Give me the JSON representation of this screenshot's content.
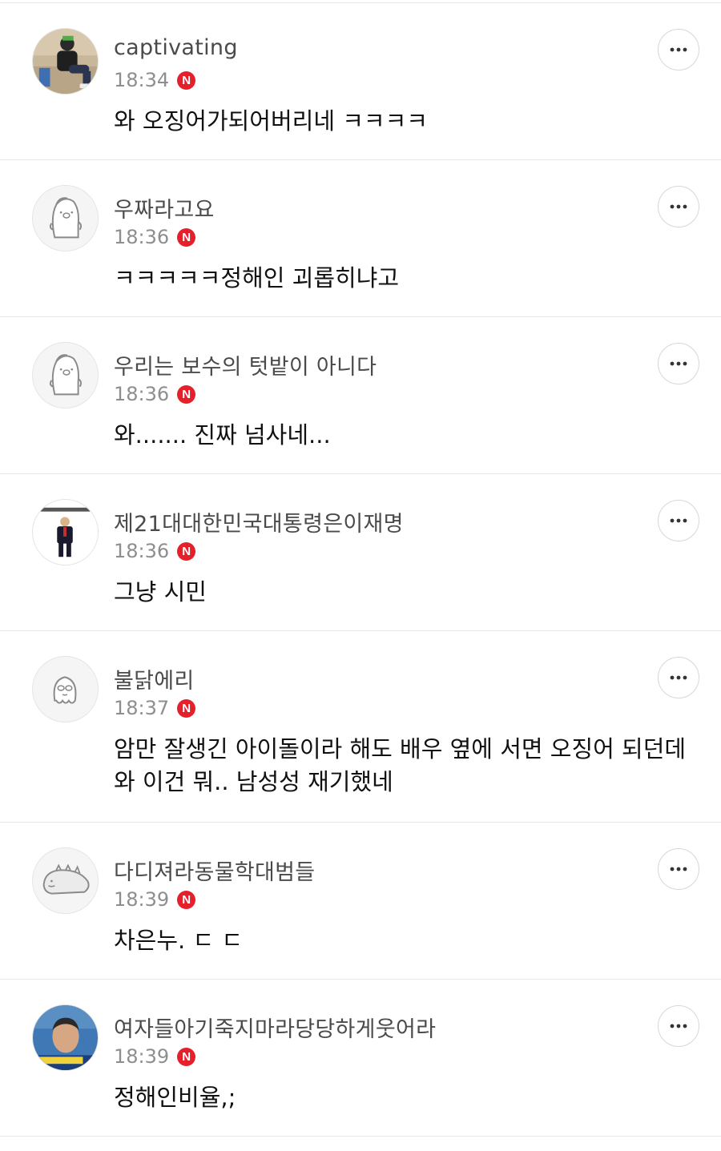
{
  "comments": [
    {
      "nickname": "captivating",
      "time": "18:34",
      "badge": "N",
      "body": "와 오징어가되어버리네 ㅋㅋㅋㅋ",
      "avatar": "photo-person-sitting"
    },
    {
      "nickname": "우짜라고요",
      "time": "18:36",
      "badge": "N",
      "body": "ㅋㅋㅋㅋㅋ정해인 괴롭히냐고",
      "avatar": "default-character"
    },
    {
      "nickname": "우리는 보수의 텃밭이 아니다",
      "time": "18:36",
      "badge": "N",
      "body": "와....... 진짜 넘사네...",
      "avatar": "default-character"
    },
    {
      "nickname": "제21대대한민국대통령은이재명",
      "time": "18:36",
      "badge": "N",
      "body": "그냥 시민",
      "avatar": "photo-man-in-suit"
    },
    {
      "nickname": "불닭에리",
      "time": "18:37",
      "badge": "N",
      "body": "암만 잘생긴 아이돌이라 해도 배우 옆에 서면 오징어 되던데\n와 이건 뭐.. 남성성 재기했네",
      "avatar": "default-octopus"
    },
    {
      "nickname": "다디져라동물학대범들",
      "time": "18:39",
      "badge": "N",
      "body": "차은누. ㄷ ㄷ",
      "avatar": "default-dinosaur"
    },
    {
      "nickname": "여자들아기죽지마라당당하게웃어라",
      "time": "18:39",
      "badge": "N",
      "body": "정해인비율,;",
      "avatar": "photo-man-face"
    }
  ],
  "colors": {
    "badge": "#e5202b",
    "divider": "#e6e6e6",
    "nickname": "#4a4a4a",
    "time": "#8e8e8e"
  },
  "icons": {
    "more": "more-horizontal-icon",
    "new_badge": "new-badge-icon"
  }
}
